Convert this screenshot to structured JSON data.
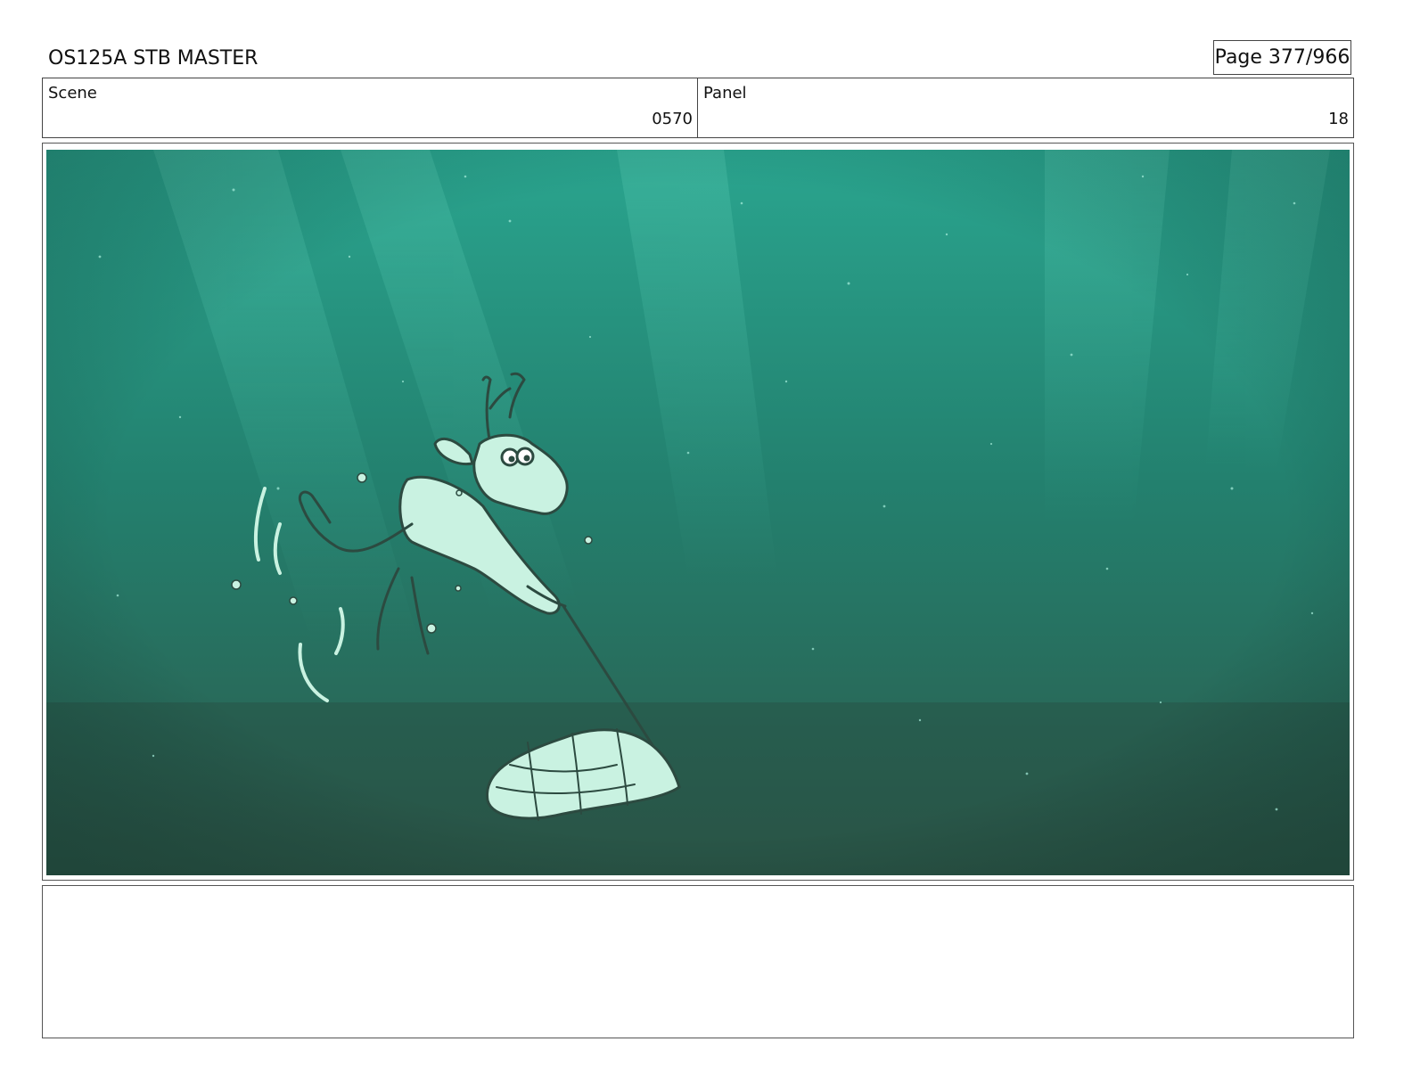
{
  "header": {
    "document_title": "OS125A STB MASTER",
    "page_label": "Page 377/966"
  },
  "info": {
    "scene_label": "Scene",
    "scene_value": "0570",
    "panel_label": "Panel",
    "panel_value": "18"
  },
  "panel_image": {
    "description_key": "underwater-sketch",
    "colors": {
      "water_top": "#2aa58f",
      "water_mid": "#23816f",
      "water_bottom": "#2c5a4b",
      "sketch_fill": "#c9f2e1",
      "sketch_line": "#2c4a40"
    }
  },
  "notes": {
    "text": ""
  }
}
